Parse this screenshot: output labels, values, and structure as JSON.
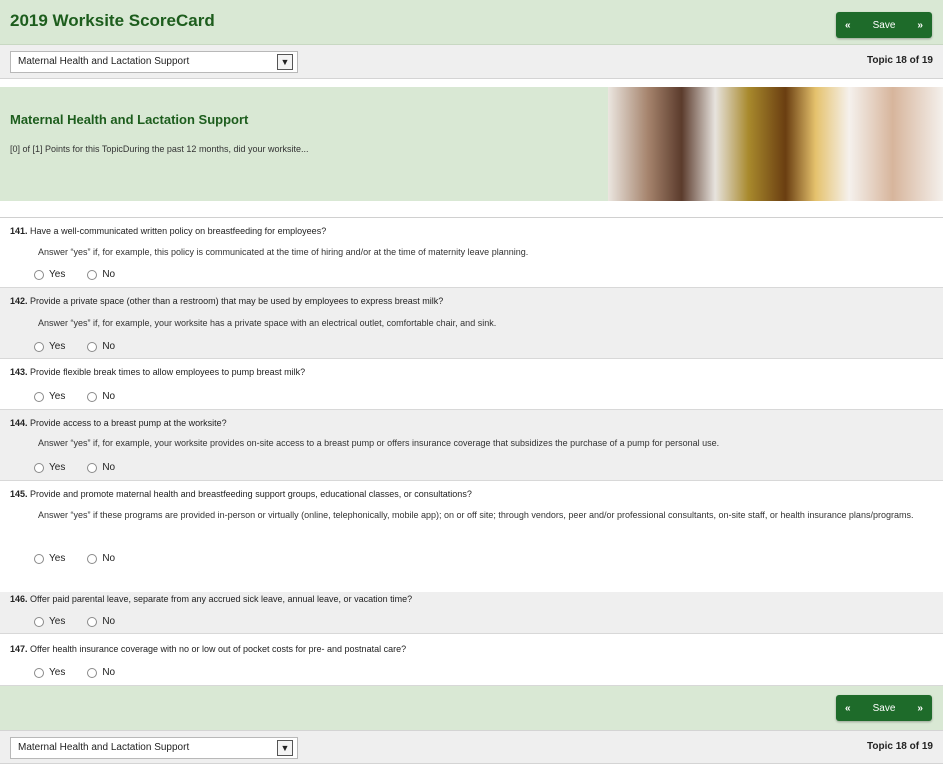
{
  "header": {
    "title": "2019 Worksite ScoreCard"
  },
  "save": {
    "label": "Save",
    "prev_icon": "chevron-left",
    "next_icon": "chevron-right",
    "color": "#1e6b2a"
  },
  "nav": {
    "selected_topic": "Maternal Health and Lactation Support",
    "counter": "Topic 18 of 19"
  },
  "banner": {
    "title": "Maternal Health and Lactation Support",
    "subtitle": "[0] of [1] Points for this TopicDuring the past 12 months, did your worksite..."
  },
  "options": {
    "yes": "Yes",
    "no": "No"
  },
  "questions": [
    {
      "num": "141.",
      "text": "Have a well-communicated written policy on breastfeeding for employees?",
      "hint": "Answer “yes” if, for example, this policy is communicated at the time of hiring and/or at the time of maternity leave planning."
    },
    {
      "num": "142.",
      "text": "Provide a private space (other than a restroom) that may be used by employees to express breast milk?",
      "hint": "Answer “yes” if, for example, your worksite has a private space with an electrical outlet, comfortable chair, and sink."
    },
    {
      "num": "143.",
      "text": "Provide flexible break times to allow employees to pump breast milk?",
      "hint": ""
    },
    {
      "num": "144.",
      "text": "Provide access to a breast pump at the worksite?",
      "hint": "Answer “yes” if, for example, your worksite provides on-site access to a breast pump or offers insurance coverage that subsidizes the purchase of a pump for personal use."
    },
    {
      "num": "145.",
      "text": "Provide and promote maternal health and breastfeeding support groups, educational classes, or consultations?",
      "hint": "Answer “yes” if these programs are provided in-person or virtually (online, telephonically, mobile app); on or off site; through vendors, peer and/or professional consultants, on-site staff, or health insurance plans/programs."
    },
    {
      "num": "146.",
      "text": "Offer paid parental leave, separate from any accrued sick leave, annual leave, or vacation time?",
      "hint": ""
    },
    {
      "num": "147.",
      "text": "Offer health insurance coverage with no or low out of pocket costs for pre- and postnatal care?",
      "hint": ""
    }
  ]
}
